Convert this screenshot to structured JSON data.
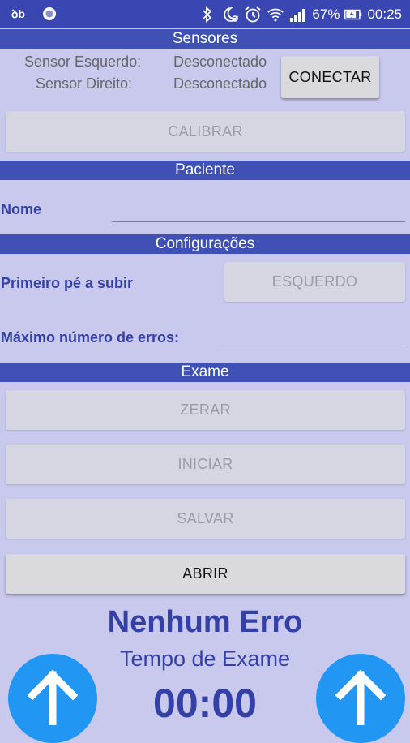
{
  "statusbar": {
    "battery": "67%",
    "time": "00:25",
    "icons": [
      "notification-app-icon",
      "circle-notification-icon",
      "bluetooth-icon",
      "do-not-disturb-icon",
      "alarm-icon",
      "wifi-icon",
      "signal-icon",
      "battery-charging-icon"
    ]
  },
  "sensors": {
    "header": "Sensores",
    "left_label": "Sensor Esquerdo:",
    "left_status": "Desconectado",
    "right_label": "Sensor Direito:",
    "right_status": "Desconectado",
    "connect_button": "CONECTAR",
    "calibrate_button": "CALIBRAR"
  },
  "patient": {
    "header": "Paciente",
    "name_label": "Nome",
    "name_value": ""
  },
  "settings": {
    "header": "Configurações",
    "first_foot_label": "Primeiro pé a subir",
    "first_foot_button": "ESQUERDO",
    "max_errors_label": "Máximo número de erros:",
    "max_errors_value": ""
  },
  "exam": {
    "header": "Exame",
    "reset_button": "ZERAR",
    "start_button": "INICIAR",
    "save_button": "SALVAR",
    "open_button": "ABRIR",
    "error_status": "Nenhum Erro",
    "time_label": "Tempo de Exame",
    "time_value": "00:00"
  },
  "colors": {
    "statusbar": "#3a47b3",
    "header": "#3f51b5",
    "background": "#c9c9ee",
    "accent_text": "#3340a8",
    "circle_button": "#2196f3"
  }
}
